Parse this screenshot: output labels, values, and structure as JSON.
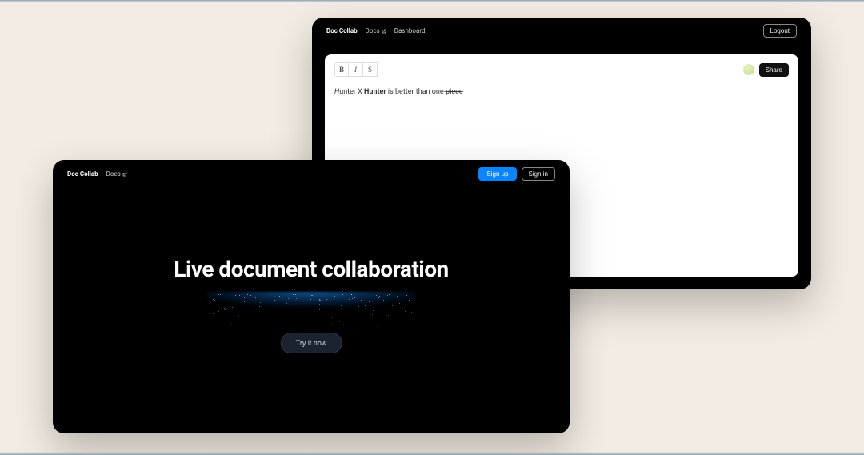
{
  "brand": "Doc Collab",
  "editor": {
    "nav": {
      "docs_label": "Docs",
      "dashboard_label": "Dashboard"
    },
    "logout_label": "Logout",
    "format": {
      "bold_label": "B",
      "italic_label": "I",
      "strike_label": "S"
    },
    "share_label": "Share",
    "content_html": "<em>H</em>unter X <strong>Hunter</strong> is better than one-<span class=\"strike\">piece</span>"
  },
  "landing": {
    "nav": {
      "docs_label": "Docs"
    },
    "signup_label": "Sign up",
    "signin_label": "Sign in",
    "hero_title": "Live document collaboration",
    "cta_label": "Try it now"
  }
}
